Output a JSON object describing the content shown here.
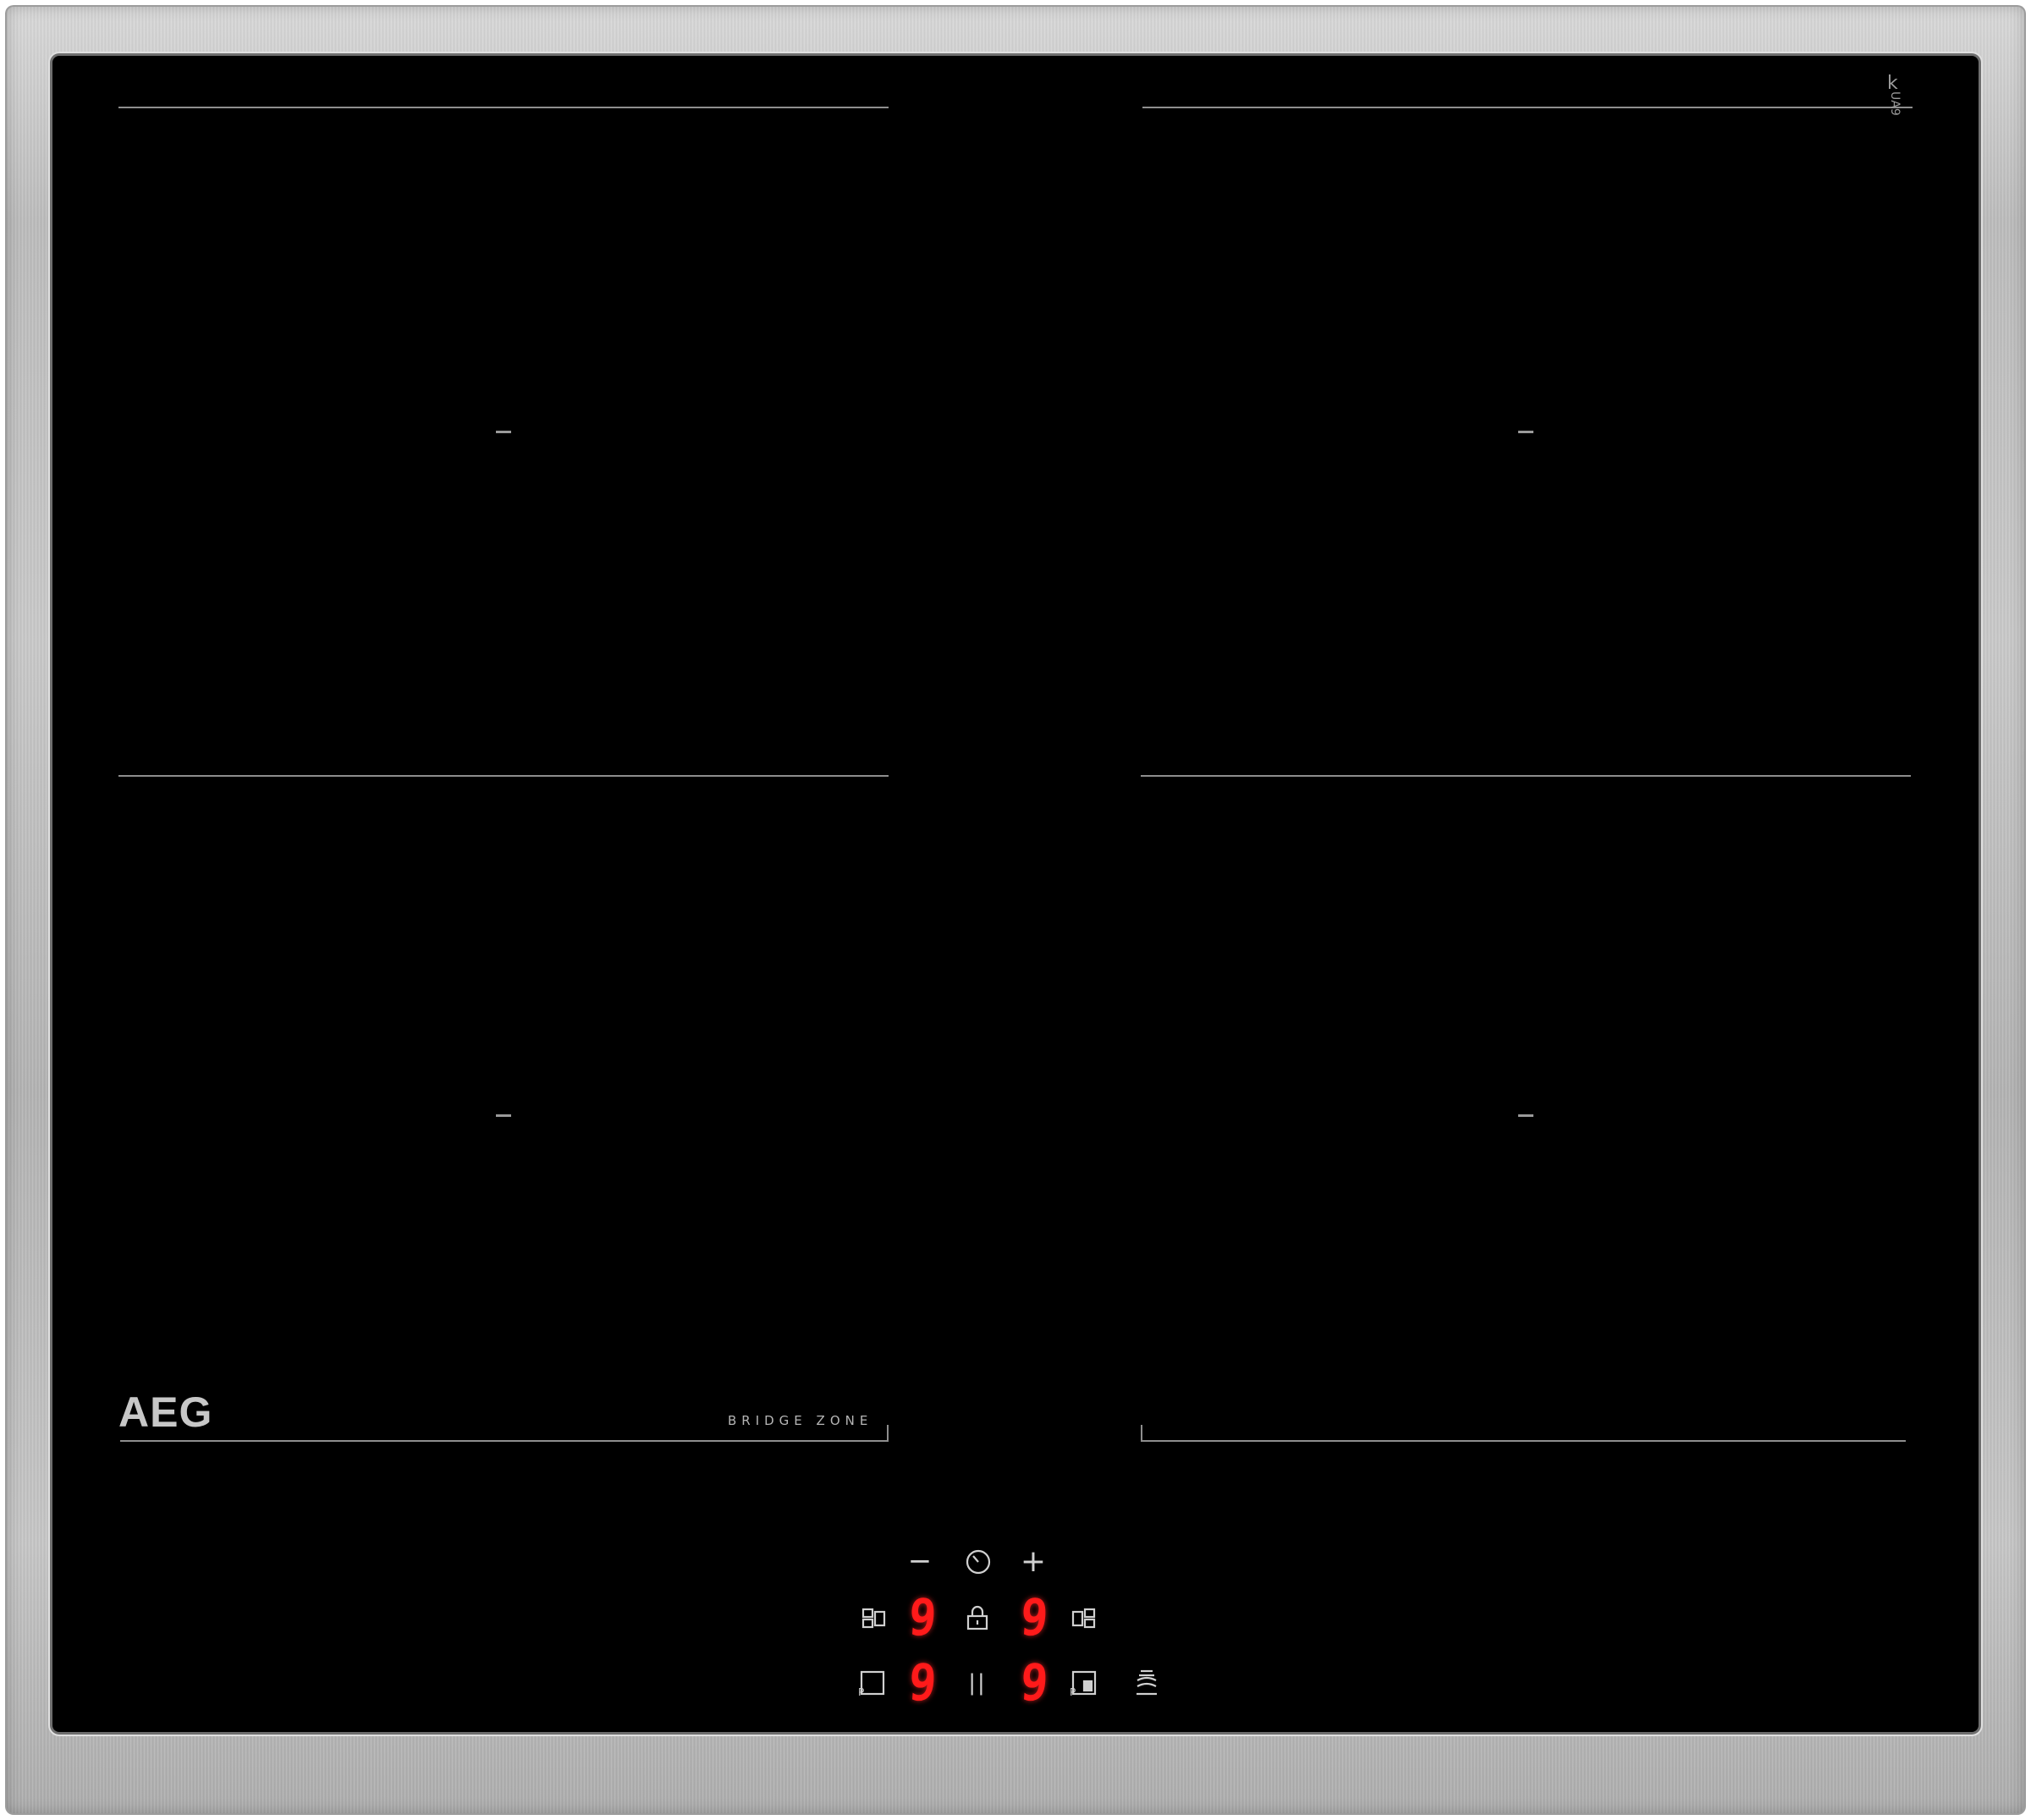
{
  "brand": {
    "logo_text": "AEG",
    "product_label": "BRIDGE ZONE",
    "cert_mark": "k",
    "cert_mark_sub": "UA9"
  },
  "colors": {
    "glass": "#000000",
    "frame": "#c2c2c2",
    "display_red": "#ff1a1a",
    "markings": "#8e8e8e"
  },
  "control_panel": {
    "timer": {
      "minus_label": "−",
      "plus_label": "+",
      "timer_icon": "clock-icon"
    },
    "displays": {
      "top_left": "9",
      "top_right": "9",
      "bottom_left": "9",
      "bottom_right": "9"
    },
    "icons": {
      "bridge_left": "bridge-left-icon",
      "lock": "lock-icon",
      "bridge_right": "bridge-right-icon",
      "power_boost_left": "power-boost-left-icon",
      "pause": "pause-icon",
      "power_boost_right": "power-boost-right-icon",
      "hob2hood": "hob2hood-icon"
    },
    "pause_label": "||"
  }
}
